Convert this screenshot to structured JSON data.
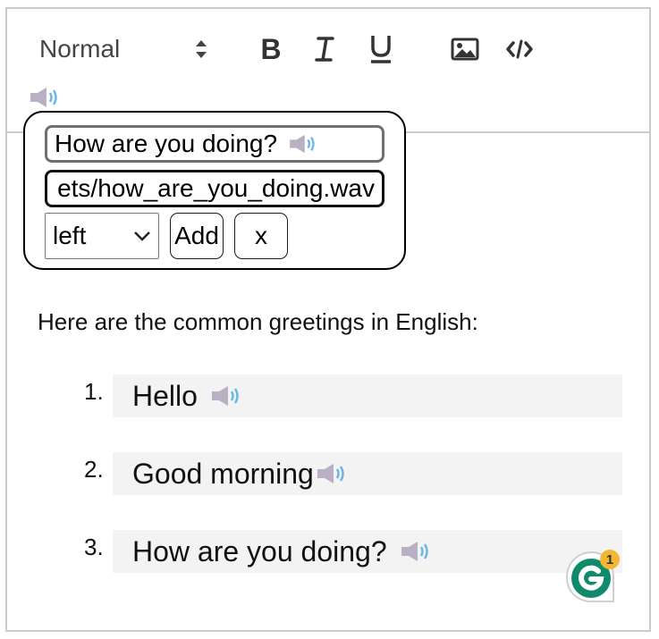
{
  "toolbar": {
    "format_select_value": "Normal",
    "buttons": [
      {
        "name": "bold-button",
        "icon": "bold-icon"
      },
      {
        "name": "italic-button",
        "icon": "italic-icon"
      },
      {
        "name": "underline-button",
        "icon": "underline-icon"
      },
      {
        "name": "image-button",
        "icon": "image-icon"
      },
      {
        "name": "code-button",
        "icon": "code-icon"
      }
    ],
    "audio_icon": "speaker-icon"
  },
  "audio_popup": {
    "text_value": "How are you doing?",
    "url_value": "ets/how_are_you_doing.wav",
    "align_value": "left",
    "add_label": "Add",
    "close_label": "x"
  },
  "content": {
    "intro": "Here are the common greetings in English:",
    "items": [
      {
        "number": "1.",
        "text": "Hello"
      },
      {
        "number": "2.",
        "text": "Good morning"
      },
      {
        "number": "3.",
        "text": "How are you doing?"
      }
    ]
  },
  "grammarly": {
    "badge_count": "1",
    "color": "#0f8a6b",
    "badge_color": "#f5b731"
  },
  "colors": {
    "border": "#cccccc",
    "chip_bg": "#f3f3f3",
    "speaker_body": "#b9b0c4",
    "speaker_waves": "#6bb6e8"
  }
}
